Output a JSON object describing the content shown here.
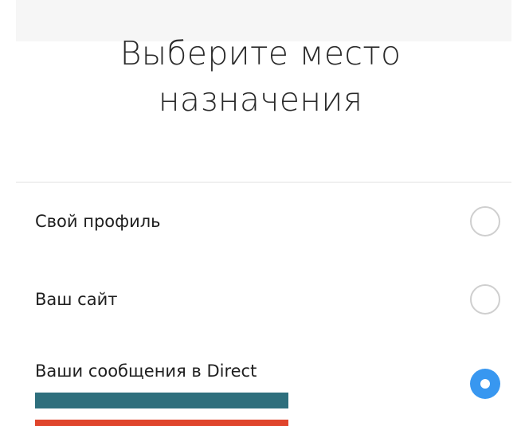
{
  "header": {
    "title_line1": "Выберите место",
    "title_line2": "назначения"
  },
  "options": [
    {
      "label": "Свой профиль",
      "selected": false
    },
    {
      "label": "Ваш сайт",
      "selected": false
    },
    {
      "label": "Ваши сообщения в Direct",
      "selected": true
    }
  ],
  "colors": {
    "accent": "#3897f0",
    "radio_border": "#cfcfcf",
    "redaction_teal": "#2e6f7d",
    "redaction_red": "#e0452c"
  }
}
